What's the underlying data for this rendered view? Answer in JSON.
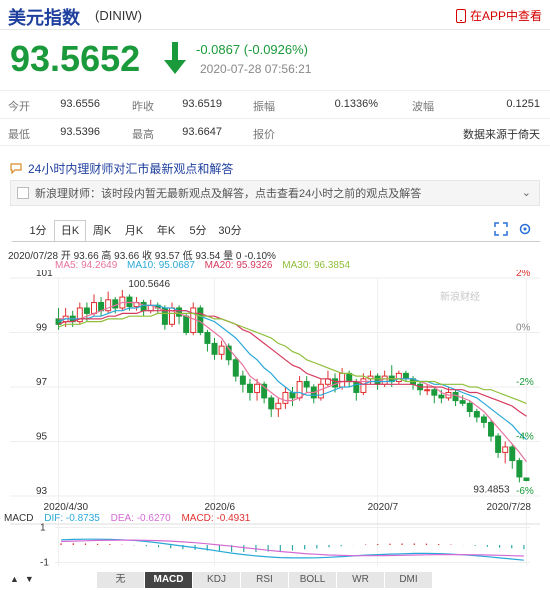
{
  "header": {
    "title": "美元指数",
    "code": "(DINIW)",
    "app_link": "在APP中查看"
  },
  "quote": {
    "price": "93.5652",
    "change": "-0.0867 (-0.0926%)",
    "time": "2020-07-28 07:56:21"
  },
  "stats": [
    [
      {
        "label": "今开",
        "value": "93.6556"
      },
      {
        "label": "昨收",
        "value": "93.6519"
      },
      {
        "label": "振幅",
        "value": "0.1336%"
      },
      {
        "label": "波幅",
        "value": "0.1251"
      }
    ],
    [
      {
        "label": "最低",
        "value": "93.5396"
      },
      {
        "label": "最高",
        "value": "93.6647"
      },
      {
        "label": "报价",
        "value": "数据来源于倚天"
      }
    ]
  ],
  "news": {
    "headline": "24小时内理财师对汇市最新观点和解答",
    "notice": "新浪理财师：该时段内暂无最新观点及解答，点击查看24小时之前的观点及解答"
  },
  "tabs": [
    "1分",
    "日K",
    "周K",
    "月K",
    "年K",
    "5分",
    "30分"
  ],
  "active_tab": "日K",
  "kline_info": "2020/07/28 开 93.66 高 93.66 收 93.57 低 93.54 量 0 -0.10%",
  "ma": [
    {
      "label": "MA5: 94.2649",
      "color": "#e8739f"
    },
    {
      "label": "MA10: 95.0687",
      "color": "#2aa8d8"
    },
    {
      "label": "MA20: 95.9326",
      "color": "#d63b5e"
    },
    {
      "label": "MA30: 96.3854",
      "color": "#8fbf3a"
    }
  ],
  "watermark": "新浪财经",
  "chart_data": {
    "type": "candlestick",
    "y_ticks": [
      "101",
      "99",
      "97",
      "95",
      "93"
    ],
    "right_ticks": [
      "2%",
      "0%",
      "-2%",
      "-4%",
      "-6%"
    ],
    "x_labels": [
      "2020/4/30",
      "2020/6",
      "2020/7",
      "2020/7/28"
    ],
    "high_label": "100.5646",
    "low_label": "93.4853",
    "candles": [
      [
        99.5,
        99.3,
        99.9,
        99.1
      ],
      [
        99.4,
        99.6,
        99.9,
        99.2
      ],
      [
        99.6,
        99.4,
        99.8,
        99.2
      ],
      [
        99.4,
        99.9,
        100.1,
        99.3
      ],
      [
        99.9,
        99.7,
        100.1,
        99.4
      ],
      [
        99.7,
        100.1,
        100.4,
        99.6
      ],
      [
        100.1,
        99.8,
        100.3,
        99.6
      ],
      [
        99.8,
        100.2,
        100.5,
        99.7
      ],
      [
        100.2,
        99.9,
        100.3,
        99.7
      ],
      [
        99.9,
        100.3,
        100.56,
        99.8
      ],
      [
        100.3,
        99.95,
        100.4,
        99.8
      ],
      [
        99.95,
        100.1,
        100.3,
        99.8
      ],
      [
        100.1,
        99.8,
        100.2,
        99.6
      ],
      [
        99.8,
        100.0,
        100.2,
        99.7
      ],
      [
        100.0,
        99.9,
        100.1,
        99.7
      ],
      [
        99.9,
        99.3,
        100.0,
        99.1
      ],
      [
        99.3,
        99.9,
        100.1,
        99.2
      ],
      [
        99.9,
        99.6,
        100.0,
        99.3
      ],
      [
        99.6,
        99.0,
        99.7,
        98.9
      ],
      [
        99.0,
        99.9,
        100.1,
        98.9
      ],
      [
        99.9,
        99.0,
        100.0,
        98.9
      ],
      [
        99.0,
        98.6,
        99.1,
        98.3
      ],
      [
        98.6,
        98.2,
        98.8,
        98.0
      ],
      [
        98.2,
        98.5,
        98.7,
        98.0
      ],
      [
        98.5,
        98.0,
        98.6,
        97.8
      ],
      [
        98.0,
        97.4,
        98.1,
        97.2
      ],
      [
        97.4,
        97.1,
        97.6,
        96.8
      ],
      [
        97.1,
        96.8,
        97.3,
        96.5
      ],
      [
        96.8,
        97.1,
        97.3,
        96.5
      ],
      [
        97.1,
        96.6,
        97.2,
        96.4
      ],
      [
        96.6,
        96.2,
        96.7,
        95.9
      ],
      [
        96.2,
        96.4,
        96.6,
        95.9
      ],
      [
        96.4,
        96.8,
        97.0,
        96.2
      ],
      [
        96.8,
        96.6,
        97.0,
        96.3
      ],
      [
        96.6,
        97.2,
        97.4,
        96.5
      ],
      [
        97.2,
        97.0,
        97.4,
        96.8
      ],
      [
        97.0,
        96.6,
        97.1,
        96.4
      ],
      [
        96.6,
        97.1,
        97.3,
        96.5
      ],
      [
        97.1,
        97.3,
        97.6,
        97.0
      ],
      [
        97.3,
        97.0,
        97.5,
        96.8
      ],
      [
        97.0,
        97.5,
        97.7,
        96.9
      ],
      [
        97.5,
        97.2,
        97.6,
        97.0
      ],
      [
        97.2,
        96.8,
        97.3,
        96.5
      ],
      [
        96.8,
        97.3,
        97.5,
        96.7
      ],
      [
        97.3,
        97.4,
        97.6,
        97.1
      ],
      [
        97.4,
        97.1,
        97.5,
        96.9
      ],
      [
        97.1,
        97.4,
        97.6,
        97.0
      ],
      [
        97.4,
        97.2,
        97.8,
        97.0
      ],
      [
        97.2,
        97.5,
        97.6,
        97.1
      ],
      [
        97.5,
        97.3,
        97.6,
        97.2
      ],
      [
        97.3,
        97.1,
        97.4,
        96.9
      ],
      [
        97.1,
        96.9,
        97.2,
        96.7
      ],
      [
        96.9,
        96.9,
        97.1,
        96.7
      ],
      [
        96.9,
        96.7,
        97.0,
        96.4
      ],
      [
        96.7,
        96.6,
        96.9,
        96.4
      ],
      [
        96.6,
        96.8,
        97.0,
        96.5
      ],
      [
        96.8,
        96.5,
        96.9,
        96.3
      ],
      [
        96.5,
        96.4,
        96.7,
        96.3
      ],
      [
        96.4,
        96.1,
        96.5,
        95.9
      ],
      [
        96.1,
        95.9,
        96.2,
        95.7
      ],
      [
        95.9,
        95.7,
        96.0,
        95.5
      ],
      [
        95.7,
        95.2,
        95.8,
        95.0
      ],
      [
        95.2,
        94.6,
        95.3,
        94.4
      ],
      [
        94.6,
        94.8,
        95.0,
        94.2
      ],
      [
        94.8,
        94.3,
        94.9,
        94.0
      ],
      [
        94.3,
        93.7,
        94.4,
        93.5
      ],
      [
        93.66,
        93.57,
        93.66,
        93.54
      ]
    ],
    "ma5": [
      99.5,
      99.5,
      99.5,
      99.5,
      99.6,
      99.7,
      99.8,
      99.9,
      100.0,
      100.1,
      100.1,
      100.1,
      100.0,
      100.0,
      99.9,
      99.8,
      99.8,
      99.7,
      99.6,
      99.5,
      99.4,
      99.2,
      99.0,
      98.8,
      98.4,
      98.1,
      97.8,
      97.4,
      97.2,
      97.0,
      96.8,
      96.6,
      96.5,
      96.5,
      96.6,
      96.8,
      96.8,
      96.9,
      97.0,
      97.1,
      97.2,
      97.2,
      97.2,
      97.2,
      97.2,
      97.2,
      97.3,
      97.3,
      97.3,
      97.3,
      97.3,
      97.2,
      97.1,
      97.0,
      96.8,
      96.7,
      96.7,
      96.6,
      96.5,
      96.3,
      96.1,
      95.8,
      95.5,
      95.2,
      94.9,
      94.6,
      94.26
    ],
    "ma10": [
      99.4,
      99.5,
      99.5,
      99.5,
      99.5,
      99.6,
      99.6,
      99.7,
      99.8,
      99.8,
      99.9,
      99.9,
      100.0,
      100.0,
      100.0,
      99.9,
      99.9,
      99.8,
      99.8,
      99.7,
      99.6,
      99.5,
      99.4,
      99.2,
      99.0,
      98.8,
      98.5,
      98.2,
      98.0,
      97.7,
      97.5,
      97.2,
      97.0,
      96.8,
      96.8,
      96.7,
      96.7,
      96.7,
      96.8,
      96.9,
      97.0,
      97.0,
      97.1,
      97.1,
      97.2,
      97.2,
      97.2,
      97.2,
      97.3,
      97.3,
      97.3,
      97.2,
      97.2,
      97.1,
      97.1,
      97.0,
      96.9,
      96.8,
      96.7,
      96.6,
      96.4,
      96.2,
      96.0,
      95.8,
      95.6,
      95.3,
      95.07
    ],
    "ma20": [
      99.3,
      99.4,
      99.4,
      99.5,
      99.5,
      99.5,
      99.5,
      99.6,
      99.6,
      99.7,
      99.7,
      99.7,
      99.8,
      99.8,
      99.8,
      99.8,
      99.8,
      99.8,
      99.8,
      99.7,
      99.7,
      99.6,
      99.6,
      99.5,
      99.4,
      99.3,
      99.1,
      99.0,
      98.8,
      98.6,
      98.4,
      98.2,
      98.0,
      97.8,
      97.7,
      97.5,
      97.4,
      97.3,
      97.3,
      97.2,
      97.2,
      97.2,
      97.2,
      97.1,
      97.1,
      97.1,
      97.1,
      97.1,
      97.1,
      97.1,
      97.1,
      97.0,
      97.0,
      97.0,
      97.0,
      96.9,
      96.9,
      96.9,
      96.8,
      96.8,
      96.7,
      96.6,
      96.5,
      96.4,
      96.3,
      96.1,
      95.93
    ],
    "ma30": [
      99.2,
      99.3,
      99.3,
      99.3,
      99.4,
      99.4,
      99.4,
      99.5,
      99.5,
      99.5,
      99.6,
      99.6,
      99.6,
      99.6,
      99.7,
      99.7,
      99.7,
      99.7,
      99.7,
      99.7,
      99.6,
      99.6,
      99.5,
      99.5,
      99.4,
      99.3,
      99.2,
      99.1,
      99.0,
      98.9,
      98.8,
      98.6,
      98.5,
      98.3,
      98.2,
      98.0,
      97.9,
      97.8,
      97.7,
      97.6,
      97.5,
      97.5,
      97.4,
      97.4,
      97.3,
      97.3,
      97.3,
      97.3,
      97.3,
      97.2,
      97.2,
      97.2,
      97.2,
      97.2,
      97.1,
      97.1,
      97.1,
      97.1,
      97.0,
      97.0,
      96.9,
      96.9,
      96.8,
      96.7,
      96.6,
      96.5,
      96.39
    ],
    "macd": {
      "dif_label": "DIF: -0.8735",
      "dea_label": "DEA: -0.6270",
      "macd_label": "MACD: -0.4931",
      "dif_color": "#2aa8d8",
      "dea_color": "#d56ad5",
      "macd_color": "#e03030",
      "y_ticks": [
        "1",
        "-1"
      ],
      "dif": [
        0.3,
        0.32,
        0.33,
        0.33,
        0.32,
        0.3,
        0.26,
        0.2,
        0.12,
        0.03,
        -0.06,
        -0.15,
        -0.25,
        -0.36,
        -0.46,
        -0.55,
        -0.62,
        -0.68,
        -0.72,
        -0.74,
        -0.74,
        -0.73,
        -0.7,
        -0.66,
        -0.62,
        -0.58,
        -0.55,
        -0.52,
        -0.5,
        -0.48,
        -0.48,
        -0.49,
        -0.52,
        -0.56,
        -0.61,
        -0.67,
        -0.74,
        -0.8,
        -0.87
      ],
      "dea": [
        0.2,
        0.22,
        0.24,
        0.26,
        0.27,
        0.28,
        0.28,
        0.27,
        0.25,
        0.22,
        0.18,
        0.13,
        0.07,
        0.0,
        -0.07,
        -0.15,
        -0.22,
        -0.3,
        -0.37,
        -0.43,
        -0.49,
        -0.53,
        -0.57,
        -0.59,
        -0.61,
        -0.61,
        -0.61,
        -0.6,
        -0.59,
        -0.57,
        -0.56,
        -0.55,
        -0.55,
        -0.55,
        -0.56,
        -0.57,
        -0.59,
        -0.61,
        -0.63
      ],
      "hist": [
        0.1,
        0.1,
        0.09,
        0.07,
        0.05,
        0.02,
        -0.02,
        -0.07,
        -0.13,
        -0.19,
        -0.24,
        -0.28,
        -0.32,
        -0.36,
        -0.39,
        -0.4,
        -0.4,
        -0.38,
        -0.35,
        -0.31,
        -0.25,
        -0.2,
        -0.13,
        -0.07,
        -0.01,
        0.03,
        0.06,
        0.08,
        0.09,
        0.09,
        0.08,
        0.06,
        0.03,
        -0.01,
        -0.05,
        -0.1,
        -0.15,
        -0.19,
        -0.24
      ]
    }
  },
  "indicator_tabs": [
    "无",
    "MACD",
    "KDJ",
    "RSI",
    "BOLL",
    "WR",
    "DMI"
  ],
  "active_indicator": "MACD",
  "colors": {
    "up": "#e03030",
    "down": "#1a9a3a",
    "brand": "#1f3f9e"
  }
}
